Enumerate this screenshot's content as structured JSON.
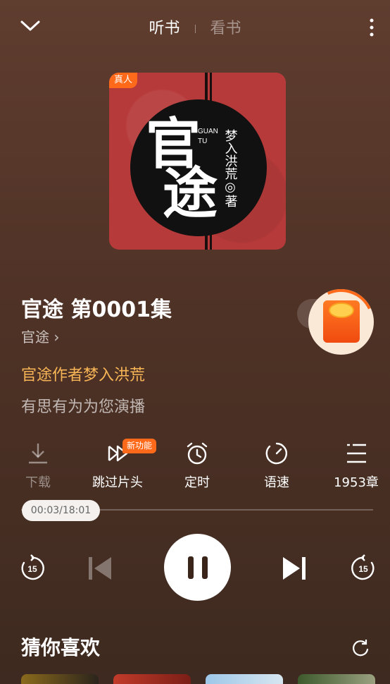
{
  "top_bar": {
    "tab_listen": "听书",
    "tab_read": "看书"
  },
  "cover": {
    "badge": "真人",
    "title_art": "官途",
    "latin": "GUAN TU",
    "author_vertical": "梦入洪荒◎著"
  },
  "episode": {
    "title": "官途 第0001集",
    "book_link": "官途 ›",
    "author_line": "官途作者梦入洪荒",
    "narrator_line": "有思有为为您演播"
  },
  "actions": [
    {
      "label": "下载",
      "icon": "download-icon",
      "disabled": true
    },
    {
      "label": "跳过片头",
      "icon": "skip-intro-icon",
      "badge": "新功能"
    },
    {
      "label": "定时",
      "icon": "alarm-clock-icon"
    },
    {
      "label": "语速",
      "icon": "speed-icon"
    },
    {
      "label": "1953章",
      "icon": "chapter-list-icon"
    }
  ],
  "progress": {
    "time_label": "00:03/18:01",
    "fraction": 0.0028
  },
  "playback": {
    "rewind_seconds": "15",
    "forward_seconds": "15"
  },
  "recommendations": {
    "title": "猜你喜欢"
  },
  "colors": {
    "accent": "#ff6a1a",
    "author_text": "#f7b556",
    "cover_red": "#b73a3a"
  }
}
